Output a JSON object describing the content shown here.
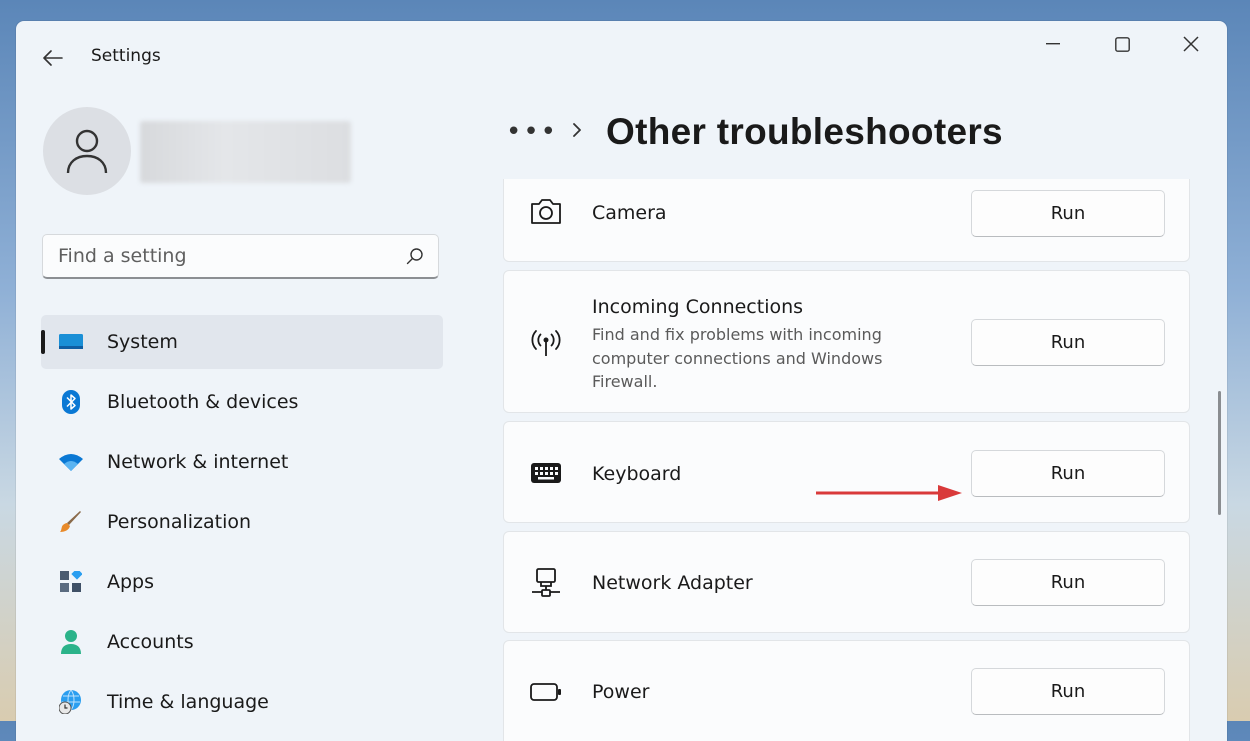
{
  "window": {
    "title": "Settings"
  },
  "search": {
    "placeholder": "Find a setting"
  },
  "sidebar": {
    "items": [
      {
        "label": "System",
        "active": true
      },
      {
        "label": "Bluetooth & devices"
      },
      {
        "label": "Network & internet"
      },
      {
        "label": "Personalization"
      },
      {
        "label": "Apps"
      },
      {
        "label": "Accounts"
      },
      {
        "label": "Time & language"
      }
    ]
  },
  "header": {
    "overflow": "•••",
    "title": "Other troubleshooters"
  },
  "troubleshooters": [
    {
      "title": "Camera",
      "icon": "camera-icon",
      "button": "Run"
    },
    {
      "title": "Incoming Connections",
      "description": "Find and fix problems with incoming computer connections and Windows Firewall.",
      "icon": "antenna-icon",
      "button": "Run"
    },
    {
      "title": "Keyboard",
      "icon": "keyboard-icon",
      "button": "Run"
    },
    {
      "title": "Network Adapter",
      "icon": "network-adapter-icon",
      "button": "Run"
    },
    {
      "title": "Power",
      "icon": "battery-icon",
      "button": "Run"
    }
  ],
  "colors": {
    "accent": "#0067c0",
    "annotation_arrow": "#d93a3a"
  }
}
